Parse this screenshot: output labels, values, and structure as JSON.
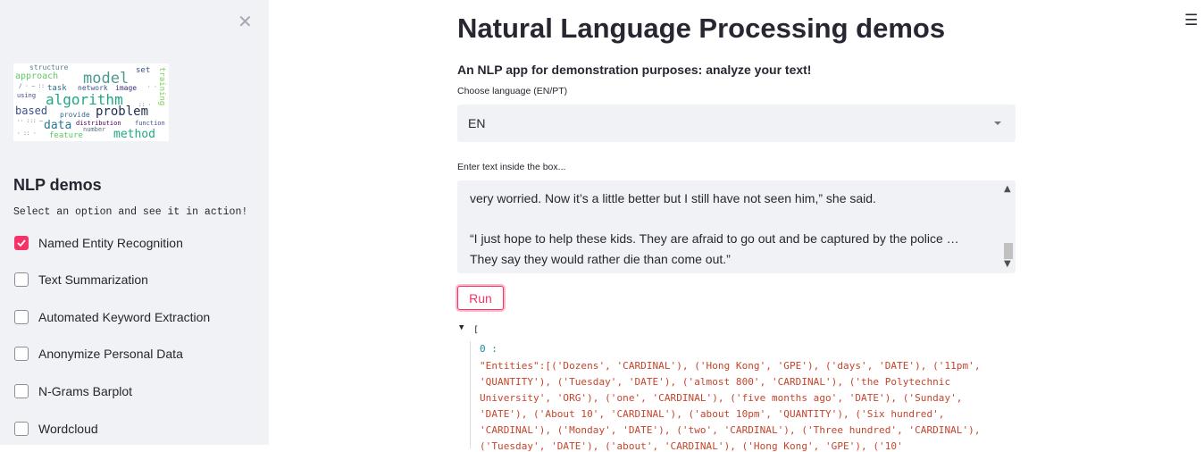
{
  "sidebar": {
    "close_icon": "close-icon",
    "title": "NLP demos",
    "subtitle": "Select an option and see it in action!",
    "options": [
      {
        "label": "Named Entity Recognition",
        "checked": true
      },
      {
        "label": "Text Summarization",
        "checked": false
      },
      {
        "label": "Automated Keyword Extraction",
        "checked": false
      },
      {
        "label": "Anonymize Personal Data",
        "checked": false
      },
      {
        "label": "N-Grams Barplot",
        "checked": false
      },
      {
        "label": "Wordcloud",
        "checked": false
      }
    ],
    "wordcloud_words": [
      "structure",
      "model",
      "set",
      "approach",
      "task",
      "network",
      "image",
      "algorithm",
      "using",
      "based",
      "problem",
      "provide",
      "data",
      "distribution",
      "number",
      "method",
      "feature",
      "function",
      "training"
    ]
  },
  "header": {
    "title": "Natural Language Processing demos",
    "menu_icon": "hamburger-menu-icon"
  },
  "main": {
    "subtitle": "An NLP app for demonstration purposes: analyze your text!",
    "language_label": "Choose language (EN/PT)",
    "language_value": "EN",
    "text_label": "Enter text inside the box...",
    "text_lines": [
      "very worried. Now it’s a little better but I still have not seen him,” she said.",
      "",
      "“I just hope to help these kids. They are afraid to go out and be captured by the police …",
      "They say they would rather die than come out.”"
    ],
    "run_label": "Run"
  },
  "output": {
    "open_bracket": "[",
    "index_key": "0 :",
    "lines": [
      "\"Entities\":[('Dozens', 'CARDINAL'), ('Hong Kong', 'GPE'), ('days', 'DATE'), ('11pm',",
      "'QUANTITY'), ('Tuesday', 'DATE'), ('almost 800', 'CARDINAL'), ('the Polytechnic",
      "University', 'ORG'), ('one', 'CARDINAL'), ('five months ago', 'DATE'), ('Sunday',",
      "'DATE'), ('About 10', 'CARDINAL'), ('about 10pm', 'QUANTITY'), ('Six hundred',",
      "'CARDINAL'), ('Monday', 'DATE'), ('two', 'CARDINAL'), ('Three hundred', 'CARDINAL'),",
      "('Tuesday', 'DATE'), ('about', 'CARDINAL'), ('Hong Kong', 'GPE'), ('10'"
    ]
  },
  "colors": {
    "accent": "#f63366",
    "sidebar_bg": "#f0f2f6",
    "json_string": "#c6442a",
    "json_key": "#1f8b94"
  }
}
